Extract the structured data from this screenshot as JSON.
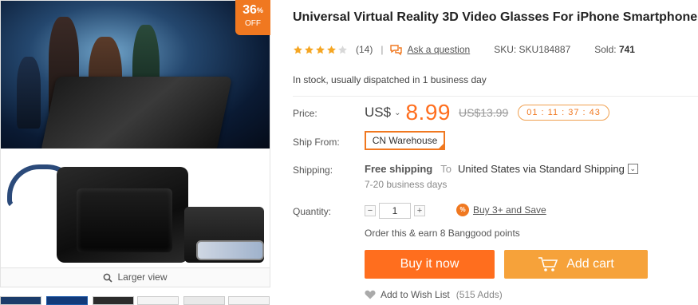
{
  "product": {
    "title": "Universal Virtual Reality 3D Video Glasses For iPhone Smartphone",
    "rating_stars": 4,
    "review_count": "(14)",
    "separator": "|",
    "ask_question": "Ask a question",
    "sku": "SKU: SKU184887",
    "sold_label": "Sold:",
    "sold_value": "741",
    "stock_status": "In stock, usually dispatched in 1 business day"
  },
  "badge": {
    "percent": "36",
    "percent_sign": "%",
    "off": "OFF"
  },
  "gallery": {
    "larger_view": "Larger view",
    "thumbnail_count": 6
  },
  "price": {
    "label": "Price:",
    "currency": "US$",
    "currency_caret": "⌄",
    "current": "8.99",
    "original": "US$13.99",
    "countdown": "01 : 11 : 37 : 43"
  },
  "ship_from": {
    "label": "Ship From:",
    "value": "CN Warehouse"
  },
  "shipping": {
    "label": "Shipping:",
    "free": "Free shipping",
    "to": "To",
    "destination": "United States via Standard Shipping",
    "dropdown_glyph": "⌄",
    "days": "7-20 business days"
  },
  "quantity": {
    "label": "Quantity:",
    "minus": "−",
    "value": "1",
    "plus": "+",
    "bulk_badge": "%",
    "bulk_offer": "Buy 3+ and Save",
    "points": "Order this & earn 8 Banggood points"
  },
  "actions": {
    "buy_now": "Buy it now",
    "add_cart": "Add cart",
    "wishlist": "Add to Wish List",
    "wishlist_adds": "(515 Adds)"
  },
  "colors": {
    "accent_orange": "#ff6e1e",
    "cart_orange": "#f6a23a",
    "badge_orange": "#f07820",
    "star_gold": "#f5a623"
  }
}
